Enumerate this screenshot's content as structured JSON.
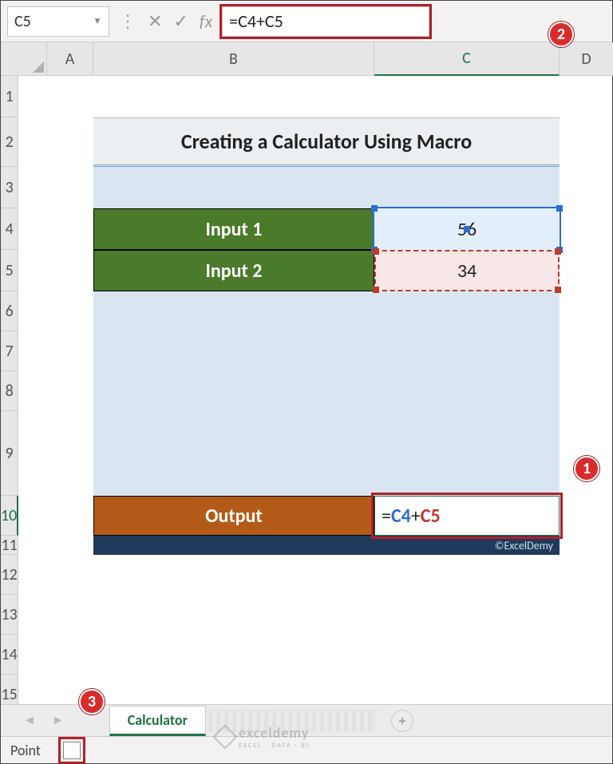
{
  "formula_bar": {
    "name_box": "C5",
    "formula": "=C4+C5"
  },
  "badges": {
    "b1": "1",
    "b2": "2",
    "b3": "3"
  },
  "columns": [
    "A",
    "B",
    "C",
    "D"
  ],
  "rows": [
    "1",
    "2",
    "3",
    "4",
    "5",
    "6",
    "7",
    "8",
    "9",
    "10",
    "11",
    "12",
    "13",
    "14",
    "15"
  ],
  "calc": {
    "title": "Creating a Calculator Using Macro",
    "input1_label": "Input 1",
    "input1_value": "56",
    "input2_label": "Input 2",
    "input2_value": "34",
    "output_label": "Output",
    "output_eq": "=",
    "output_ref1": "C4",
    "output_plus": "+",
    "output_ref2": "C5",
    "copyright": "©ExcelDemy"
  },
  "tabs": {
    "active": "Calculator",
    "add": "+"
  },
  "status": {
    "mode": "Point"
  },
  "watermark": {
    "brand": "exceldemy",
    "sub": "EXCEL · DATA · BI"
  }
}
